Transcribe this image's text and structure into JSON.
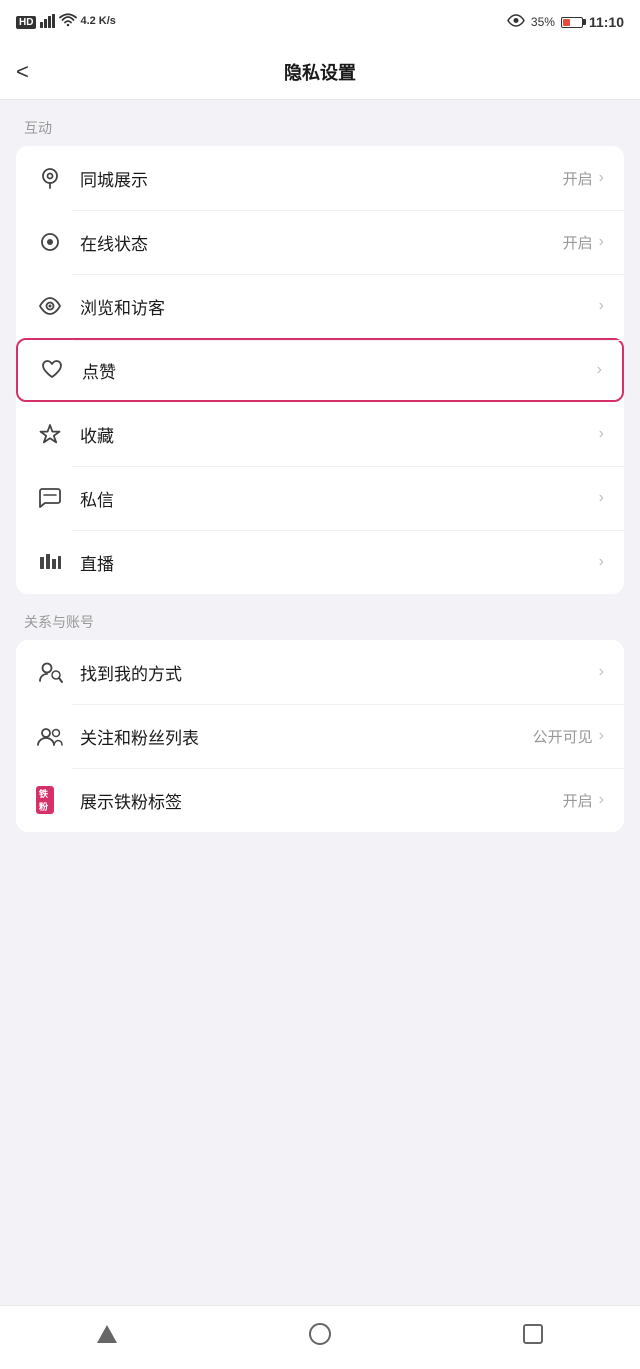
{
  "statusBar": {
    "left": "HD 4G",
    "network": "4.2 K/s",
    "batteryPercent": "35%",
    "time": "11:10"
  },
  "navBar": {
    "back": "<",
    "title": "隐私设置"
  },
  "sections": [
    {
      "label": "互动",
      "items": [
        {
          "id": "tongcheng",
          "icon": "location",
          "label": "同城展示",
          "value": "开启",
          "chevron": "›",
          "highlighted": false
        },
        {
          "id": "online-status",
          "icon": "online",
          "label": "在线状态",
          "value": "开启",
          "chevron": "›",
          "highlighted": false
        },
        {
          "id": "browse-visitors",
          "icon": "eye",
          "label": "浏览和访客",
          "value": "",
          "chevron": "›",
          "highlighted": false
        },
        {
          "id": "likes",
          "icon": "heart",
          "label": "点赞",
          "value": "",
          "chevron": "›",
          "highlighted": true
        },
        {
          "id": "favorites",
          "icon": "star",
          "label": "收藏",
          "value": "",
          "chevron": "›",
          "highlighted": false
        },
        {
          "id": "messages",
          "icon": "message",
          "label": "私信",
          "value": "",
          "chevron": "›",
          "highlighted": false
        },
        {
          "id": "live",
          "icon": "live",
          "label": "直播",
          "value": "",
          "chevron": "›",
          "highlighted": false
        }
      ]
    },
    {
      "label": "关系与账号",
      "items": [
        {
          "id": "find-me",
          "icon": "find-user",
          "label": "找到我的方式",
          "value": "",
          "chevron": "›",
          "highlighted": false
        },
        {
          "id": "follow-fans",
          "icon": "users",
          "label": "关注和粉丝列表",
          "value": "公开可见",
          "chevron": "›",
          "highlighted": false
        },
        {
          "id": "tiefan-badge",
          "icon": "tiefan",
          "label": "展示铁粉标签",
          "value": "开启",
          "chevron": "›",
          "highlighted": false
        }
      ]
    }
  ],
  "bottomNav": {
    "back": "back",
    "home": "home",
    "recent": "recent"
  }
}
